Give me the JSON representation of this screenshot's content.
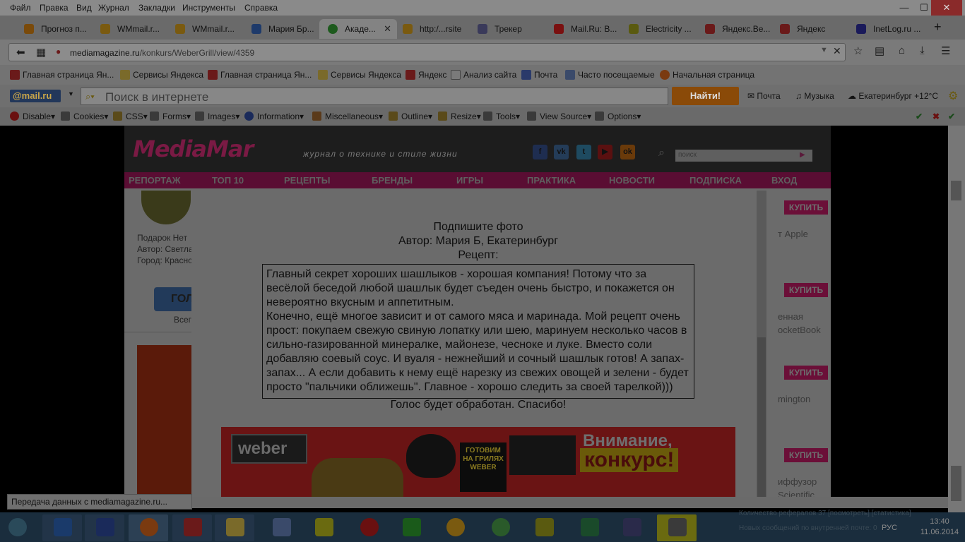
{
  "menubar": {
    "items": [
      "Файл",
      "Правка",
      "Вид",
      "Журнал",
      "Закладки",
      "Инструменты",
      "Справка"
    ]
  },
  "tabs": [
    {
      "label": "Прогноз п...",
      "color": "#7a4a0a"
    },
    {
      "label": "WMmail.r...",
      "color": "#7a5a10"
    },
    {
      "label": "WMmail.r...",
      "color": "#7a5a10"
    },
    {
      "label": "Мария Бр...",
      "color": "#1e3a6a"
    },
    {
      "label": "Акаде...",
      "color": "#1d5a1d",
      "active": true
    },
    {
      "label": "http:/...rsite",
      "color": "#7a5a10"
    },
    {
      "label": "Трекер",
      "color": "#3a3a5a"
    },
    {
      "label": "Mail.Ru: В...",
      "color": "#7a1010"
    },
    {
      "label": "Electricity ...",
      "color": "#5a5a10"
    },
    {
      "label": "Яндекс.Ве...",
      "color": "#6a1a1a"
    },
    {
      "label": "Яндекс",
      "color": "#6a1a1a"
    },
    {
      "label": "InetLog.ru ...",
      "color": "#1a1a5a"
    }
  ],
  "address": {
    "host": "mediamagazine.ru",
    "path": "/konkurs/WeberGrill/view/4359"
  },
  "bookmarks": [
    {
      "label": "Главная страница Ян...",
      "icon": "yandex-icon",
      "color": "#6a1a1a"
    },
    {
      "label": "Сервисы Яндекса",
      "icon": "folder-icon",
      "color": "#7a6a2a"
    },
    {
      "label": "Главная страница Ян...",
      "icon": "yandex-icon",
      "color": "#6a1a1a"
    },
    {
      "label": "Сервисы Яндекса",
      "icon": "folder-icon",
      "color": "#7a6a2a"
    },
    {
      "label": "Яндекс",
      "icon": "yandex-icon",
      "color": "#6a1a1a"
    },
    {
      "label": "Анализ сайта",
      "icon": "page-icon",
      "color": "#7a7a7a"
    },
    {
      "label": "Почта",
      "icon": "mail-icon",
      "color": "#2a3a6a"
    },
    {
      "label": "Часто посещаемые",
      "icon": "gear-icon",
      "color": "#3a4a6a"
    },
    {
      "label": "Начальная страница",
      "icon": "firefox-icon",
      "color": "#7a3a10"
    }
  ],
  "mailbar": {
    "logo": "@mail.ru",
    "search_placeholder": "Поиск в интернете",
    "find_button": "Найти!",
    "mail": "Почта",
    "music": "Музыка",
    "weather": "Екатеринбург +12°C"
  },
  "devbar": [
    "Disable",
    "Cookies",
    "CSS",
    "Forms",
    "Images",
    "Information",
    "Miscellaneous",
    "Outline",
    "Resize",
    "Tools",
    "View Source",
    "Options"
  ],
  "site": {
    "logo": "MediaMar",
    "tagline": "журнал о технике и стиле жизни",
    "search_placeholder": "поиск",
    "nav": [
      "РЕПОРТАЖ",
      "ТОП 10",
      "РЕЦЕПТЫ",
      "БРЕНДЫ",
      "ИГРЫ",
      "ПРАКТИКА",
      "НОВОСТИ",
      "ПОДПИСКА",
      "ВХОД"
    ],
    "left_gift": "Подарок Нет",
    "left_author": "Автор: Светла",
    "left_city": "Город: Красно",
    "vote_button": "ГОЛ",
    "vote_sub": "Всег",
    "buy_label": "КУПИТЬ",
    "right_items": [
      "т Apple",
      "енная",
      "ocketBook",
      "mington",
      "иффузор",
      "Scientific"
    ]
  },
  "modal": {
    "caption_label": "Подпишите фото",
    "author": "Автор: Мария Б, Екатеринбург",
    "recipe_label": "Рецепт:",
    "recipe_p1": "Главный секрет хороших шашлыков - хорошая компания! Потому что за весёлой беседой любой шашлык будет съеден очень быстро, и покажется он невероятно вкусным и аппетитным.",
    "recipe_p2": "Конечно, ещё многое зависит и от самого мяса и маринада. Мой рецепт очень прост: покупаем свежую свиную лопатку или шею, маринуем несколько часов в сильно-газированной минералке, майонезе, чесноке и луке. Вместо соли добавляю соевый соус. И вуаля - нежнейший и сочный шашлык готов! А запах-запах... А если добавить к нему ещё нарезку из свежих овощей и зелени - будет просто \"пальчики оближешь\". Главное - хорошо следить за своей тарелкой)))",
    "footer": "Голос будет обработан. Спасибо!"
  },
  "banner": {
    "brand": "weber",
    "book": "ГОТОВИМ НА ГРИЛЯХ WEBER",
    "title": "Внимание,",
    "subtitle": "конкурс!"
  },
  "status": "Передача данных с mediamagazine.ru...",
  "tray": {
    "line1": "Количество рефералов 37 [посмотреть] [статистика]",
    "line2": "Новых сообщений по внутренней почте: 0",
    "lang": "РУС",
    "time": "13:40",
    "date": "11.06.2014"
  },
  "taskbar_apps": [
    {
      "name": "start-button",
      "color": "#2a4a5a"
    },
    {
      "name": "app-grid-icon",
      "color": "#1a3a6a"
    },
    {
      "name": "floppy-icon",
      "color": "#1a2a5a"
    },
    {
      "name": "firefox-icon",
      "color": "#7a3a10"
    },
    {
      "name": "yandex-browser-icon",
      "color": "#6a1a1a"
    },
    {
      "name": "explorer-folder-icon",
      "color": "#7a6a2a"
    },
    {
      "name": "speaker-icon",
      "color": "#3a4a6a"
    },
    {
      "name": "ip-icon",
      "color": "#6a6a10"
    },
    {
      "name": "yandex-y-icon",
      "color": "#6a1010"
    },
    {
      "name": "a-app-icon",
      "color": "#1a5a1a"
    },
    {
      "name": "mail-agent-icon",
      "color": "#7a5a10"
    },
    {
      "name": "utorrent-icon",
      "color": "#2a5a2a"
    },
    {
      "name": "bat-icon",
      "color": "#5a5a10"
    },
    {
      "name": "excel-icon",
      "color": "#1a4a2a"
    },
    {
      "name": "eye-app-icon",
      "color": "#2a2a4a"
    },
    {
      "name": "calendar-app-icon",
      "color": "#6a6a10"
    }
  ]
}
